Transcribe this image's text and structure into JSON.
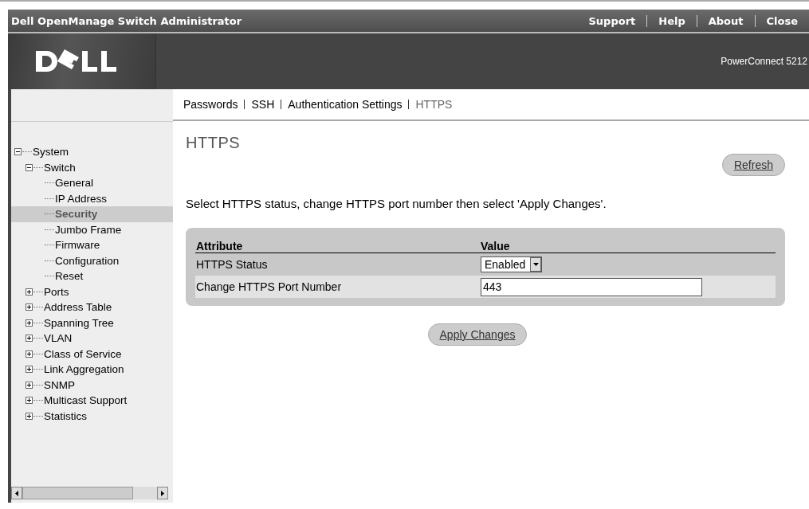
{
  "window": {
    "title": "Dell OpenManage Switch Administrator"
  },
  "top_links": [
    "Support",
    "Help",
    "About",
    "Close"
  ],
  "banner": {
    "product": "PowerConnect 5212"
  },
  "subnav": [
    {
      "label": "Passwords",
      "selected": false
    },
    {
      "label": "SSH",
      "selected": false
    },
    {
      "label": "Authentication Settings",
      "selected": false
    },
    {
      "label": "HTTPS",
      "selected": true
    }
  ],
  "tree": [
    {
      "label": "System",
      "expanded": true,
      "selected": false,
      "children": [
        {
          "label": "Switch",
          "expanded": true,
          "selected": false,
          "children": [
            {
              "label": "General",
              "selected": false
            },
            {
              "label": "IP Address",
              "selected": false
            },
            {
              "label": "Security",
              "selected": true
            },
            {
              "label": "Jumbo Frame",
              "selected": false
            },
            {
              "label": "Firmware",
              "selected": false
            },
            {
              "label": "Configuration",
              "selected": false
            },
            {
              "label": "Reset",
              "selected": false
            }
          ]
        },
        {
          "label": "Ports",
          "expanded": false,
          "selected": false
        },
        {
          "label": "Address Table",
          "expanded": false,
          "selected": false
        },
        {
          "label": "Spanning Tree",
          "expanded": false,
          "selected": false
        },
        {
          "label": "VLAN",
          "expanded": false,
          "selected": false
        },
        {
          "label": "Class of Service",
          "expanded": false,
          "selected": false
        },
        {
          "label": "Link Aggregation",
          "expanded": false,
          "selected": false
        },
        {
          "label": "SNMP",
          "expanded": false,
          "selected": false
        },
        {
          "label": "Multicast Support",
          "expanded": false,
          "selected": false
        },
        {
          "label": "Statistics",
          "expanded": false,
          "selected": false
        }
      ]
    }
  ],
  "page": {
    "title": "HTTPS",
    "refresh": "Refresh",
    "instructions": "Select HTTPS status, change HTTPS port number then select 'Apply Changes'.",
    "table": {
      "columns": [
        "Attribute",
        "Value"
      ],
      "rows": [
        {
          "attribute": "HTTPS Status",
          "kind": "select",
          "value": "Enabled"
        },
        {
          "attribute": "Change HTTPS Port Number",
          "kind": "input",
          "value": "443"
        }
      ]
    },
    "apply": "Apply Changes"
  }
}
